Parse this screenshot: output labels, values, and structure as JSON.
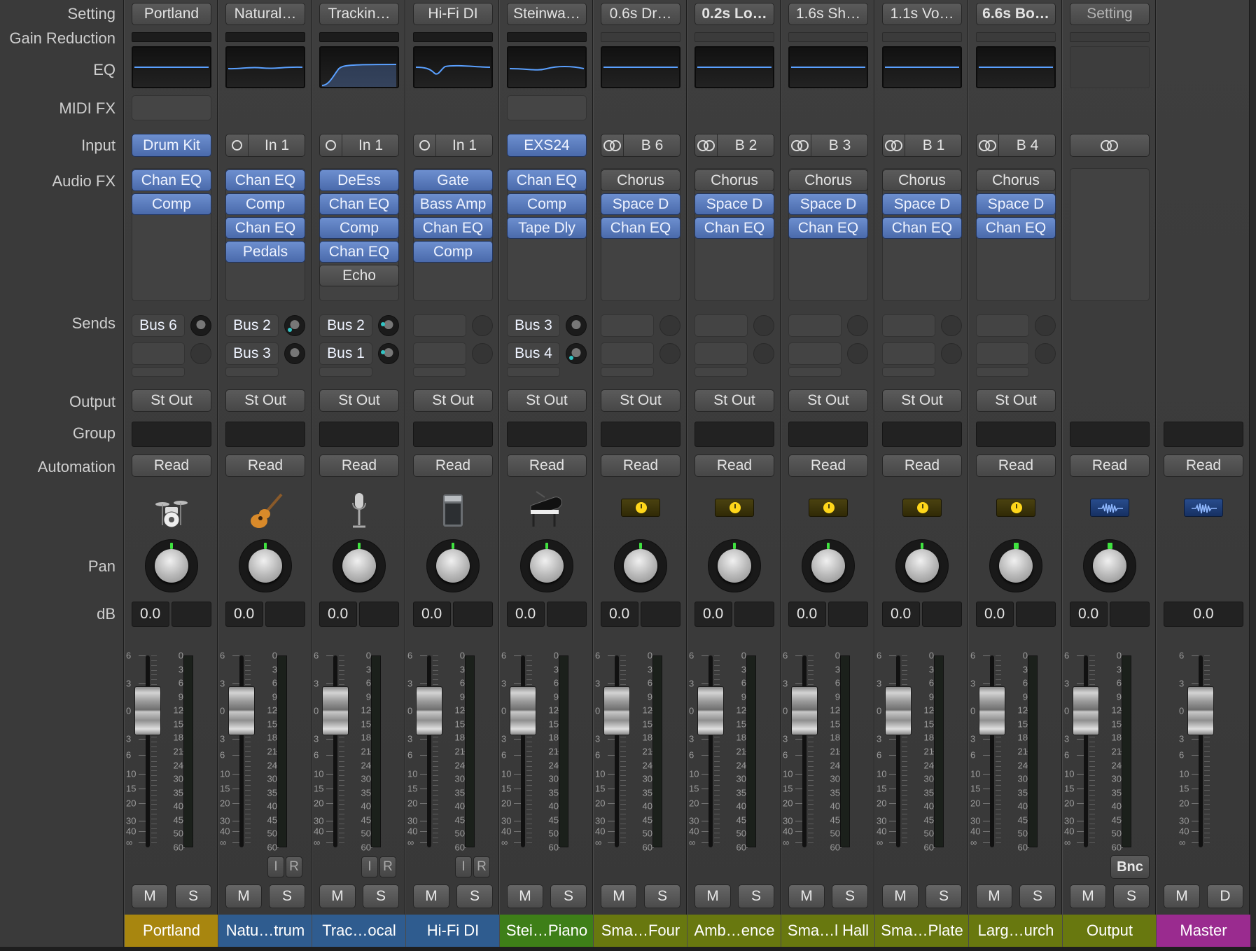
{
  "labels": {
    "setting": "Setting",
    "gain_reduction": "Gain Reduction",
    "eq": "EQ",
    "midi_fx": "MIDI FX",
    "input": "Input",
    "audio_fx": "Audio FX",
    "sends": "Sends",
    "output": "Output",
    "group": "Group",
    "automation": "Automation",
    "pan": "Pan",
    "db": "dB"
  },
  "buttons": {
    "mute": "M",
    "solo": "S",
    "dim": "D",
    "input_monitor": "I",
    "record": "R",
    "bounce": "Bnc"
  },
  "fader_scale": [
    "6",
    "3",
    "0",
    "3",
    "6",
    "10",
    "15",
    "20",
    "30",
    "40",
    "∞"
  ],
  "meter_scale": [
    "0",
    "3",
    "6",
    "9",
    "12",
    "15",
    "18",
    "21",
    "24",
    "30",
    "35",
    "40",
    "45",
    "50",
    "60"
  ],
  "strips": [
    {
      "type": "audio",
      "name": "Portland",
      "name_color": "#a8860f",
      "setting": "Portland",
      "eq": "flat",
      "midi_slot": true,
      "input": {
        "kind": "instrument",
        "label": "Drum Kit"
      },
      "fx": [
        "Chan EQ",
        "Comp"
      ],
      "sends": [
        {
          "label": "Bus 6",
          "active": true,
          "tick": "none"
        },
        {
          "label": "",
          "active": false
        }
      ],
      "output": "St Out",
      "automation": "Read",
      "icon": "drum-kit-icon",
      "pan_big": false,
      "db": "0.0",
      "peak": "",
      "ir": false
    },
    {
      "type": "audio",
      "name": "Natu…trum",
      "name_color": "#2f5c8f",
      "setting": "Natural…",
      "eq": "wave1",
      "midi_slot": false,
      "input": {
        "kind": "mono",
        "label": "In 1"
      },
      "fx": [
        "Chan EQ",
        "Comp",
        "Chan EQ",
        "Pedals"
      ],
      "sends": [
        {
          "label": "Bus 2",
          "active": true,
          "tick": "cyan-low"
        },
        {
          "label": "Bus 3",
          "active": true,
          "tick": "none"
        }
      ],
      "output": "St Out",
      "automation": "Read",
      "icon": "acoustic-guitar-icon",
      "pan_big": false,
      "db": "0.0",
      "peak": "",
      "ir": true
    },
    {
      "type": "audio",
      "name": "Trac…ocal",
      "name_color": "#2f5c8f",
      "setting": "Trackin…",
      "eq": "highpass",
      "midi_slot": false,
      "input": {
        "kind": "mono",
        "label": "In 1"
      },
      "fx": [
        "DeEss",
        "Chan EQ",
        "Comp",
        "Chan EQ"
      ],
      "fx_off": [
        "Echo"
      ],
      "sends": [
        {
          "label": "Bus 2",
          "active": true,
          "tick": "cyan-left"
        },
        {
          "label": "Bus 1",
          "active": true,
          "tick": "cyan-left"
        }
      ],
      "output": "St Out",
      "automation": "Read",
      "icon": "microphone-icon",
      "pan_big": false,
      "db": "0.0",
      "peak": "",
      "ir": true
    },
    {
      "type": "audio",
      "name": "Hi-Fi DI",
      "name_color": "#2f5c8f",
      "setting": "Hi-Fi DI",
      "eq": "notch",
      "midi_slot": false,
      "input": {
        "kind": "mono",
        "label": "In 1"
      },
      "fx": [
        "Gate",
        "Bass Amp",
        "Chan EQ",
        "Comp"
      ],
      "sends": [
        {
          "label": "",
          "active": false
        },
        {
          "label": "",
          "active": false
        }
      ],
      "output": "St Out",
      "automation": "Read",
      "icon": "bass-amp-icon",
      "pan_big": false,
      "db": "0.0",
      "peak": "",
      "ir": true
    },
    {
      "type": "audio",
      "name": "Stei…Piano",
      "name_color": "#3e7f18",
      "setting": "Steinwa…",
      "eq": "wave2",
      "midi_slot": true,
      "input": {
        "kind": "instrument",
        "label": "EXS24"
      },
      "fx": [
        "Chan EQ",
        "Comp",
        "Tape Dly"
      ],
      "sends": [
        {
          "label": "Bus 3",
          "active": true,
          "tick": "none"
        },
        {
          "label": "Bus 4",
          "active": true,
          "tick": "cyan-low"
        }
      ],
      "output": "St Out",
      "automation": "Read",
      "icon": "grand-piano-icon",
      "pan_big": false,
      "db": "0.0",
      "peak": "",
      "ir": false
    },
    {
      "type": "aux",
      "name": "Sma…Four",
      "name_color": "#68780f",
      "setting": "0.6s Dr…",
      "eq": "flat",
      "midi_slot": false,
      "input": {
        "kind": "bus",
        "label": "B 6"
      },
      "fx": [
        "Space D",
        "Chan EQ"
      ],
      "fx_top_off": "Chorus",
      "sends": [
        {
          "label": "",
          "active": false
        },
        {
          "label": "",
          "active": false
        }
      ],
      "output": "St Out",
      "automation": "Read",
      "icon": "aux-icon",
      "pan_big": false,
      "db": "0.0",
      "peak": "",
      "ir": false
    },
    {
      "type": "aux",
      "name": "Amb…ence",
      "name_color": "#68780f",
      "setting": "0.2s Lo…",
      "setting_bold": true,
      "eq": "flat",
      "midi_slot": false,
      "input": {
        "kind": "bus",
        "label": "B 2"
      },
      "fx": [
        "Space D",
        "Chan EQ"
      ],
      "fx_top_off": "Chorus",
      "sends": [
        {
          "label": "",
          "active": false
        },
        {
          "label": "",
          "active": false
        }
      ],
      "output": "St Out",
      "automation": "Read",
      "icon": "aux-icon",
      "pan_big": false,
      "db": "0.0",
      "peak": "",
      "ir": false
    },
    {
      "type": "aux",
      "name": "Sma…l Hall",
      "name_color": "#68780f",
      "setting": "1.6s Sh…",
      "eq": "flat",
      "midi_slot": false,
      "input": {
        "kind": "bus",
        "label": "B 3"
      },
      "fx": [
        "Space D",
        "Chan EQ"
      ],
      "fx_top_off": "Chorus",
      "sends": [
        {
          "label": "",
          "active": false
        },
        {
          "label": "",
          "active": false
        }
      ],
      "output": "St Out",
      "automation": "Read",
      "icon": "aux-icon",
      "pan_big": false,
      "db": "0.0",
      "peak": "",
      "ir": false
    },
    {
      "type": "aux",
      "name": "Sma…Plate",
      "name_color": "#68780f",
      "setting": "1.1s Vo…",
      "eq": "flat",
      "midi_slot": false,
      "input": {
        "kind": "bus",
        "label": "B 1"
      },
      "fx": [
        "Space D",
        "Chan EQ"
      ],
      "fx_top_off": "Chorus",
      "sends": [
        {
          "label": "",
          "active": false
        },
        {
          "label": "",
          "active": false
        }
      ],
      "output": "St Out",
      "automation": "Read",
      "icon": "aux-icon",
      "pan_big": false,
      "db": "0.0",
      "peak": "",
      "ir": false
    },
    {
      "type": "aux",
      "name": "Larg…urch",
      "name_color": "#68780f",
      "setting": "6.6s Bo…",
      "setting_bold": true,
      "eq": "flat",
      "midi_slot": false,
      "input": {
        "kind": "bus",
        "label": "B 4"
      },
      "fx": [
        "Space D",
        "Chan EQ"
      ],
      "fx_top_off": "Chorus",
      "sends": [
        {
          "label": "",
          "active": false
        },
        {
          "label": "",
          "active": false
        }
      ],
      "output": "St Out",
      "automation": "Read",
      "icon": "aux-icon",
      "pan_big": true,
      "db": "0.0",
      "peak": "",
      "ir": false
    },
    {
      "type": "output",
      "name": "Output",
      "name_color": "#68780f",
      "setting": "Setting",
      "eq": "empty",
      "midi_slot": false,
      "input": {
        "kind": "stereo",
        "label": ""
      },
      "fx": [],
      "sends": [],
      "output": "",
      "automation": "Read",
      "icon": "output-icon",
      "pan_big": true,
      "db": "0.0",
      "peak": "",
      "ir": false
    },
    {
      "type": "master",
      "name": "Master",
      "name_color": "#9a2b8f",
      "setting": "",
      "eq": "none",
      "midi_slot": false,
      "input": null,
      "fx": [],
      "sends": [],
      "output": "",
      "automation": "Read",
      "icon": "output-icon",
      "pan_big": false,
      "db": "0.0",
      "peak": "",
      "ir": false
    }
  ]
}
